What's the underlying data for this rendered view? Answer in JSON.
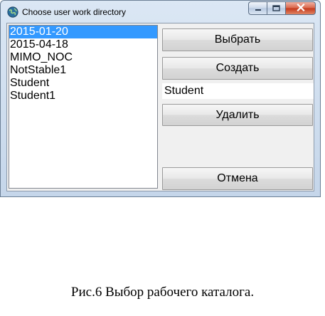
{
  "window": {
    "title": "Choose user work directory",
    "icon": "globe-icon",
    "controls": [
      "minimize-icon",
      "maximize-icon",
      "close-icon"
    ]
  },
  "directory_list": {
    "items": [
      "2015-01-20",
      "2015-04-18",
      "MIMO_NOC",
      "NotStable1",
      "Student",
      "Student1"
    ],
    "selected": "2015-01-20"
  },
  "buttons": {
    "select": "Выбрать",
    "create": "Создать",
    "delete": "Удалить",
    "cancel": "Отмена"
  },
  "name_input": {
    "value": "Student"
  },
  "caption": "Рис.6 Выбор рабочего каталога.",
  "colors": {
    "selection": "#3399ff",
    "close_button": "#c4391c"
  }
}
